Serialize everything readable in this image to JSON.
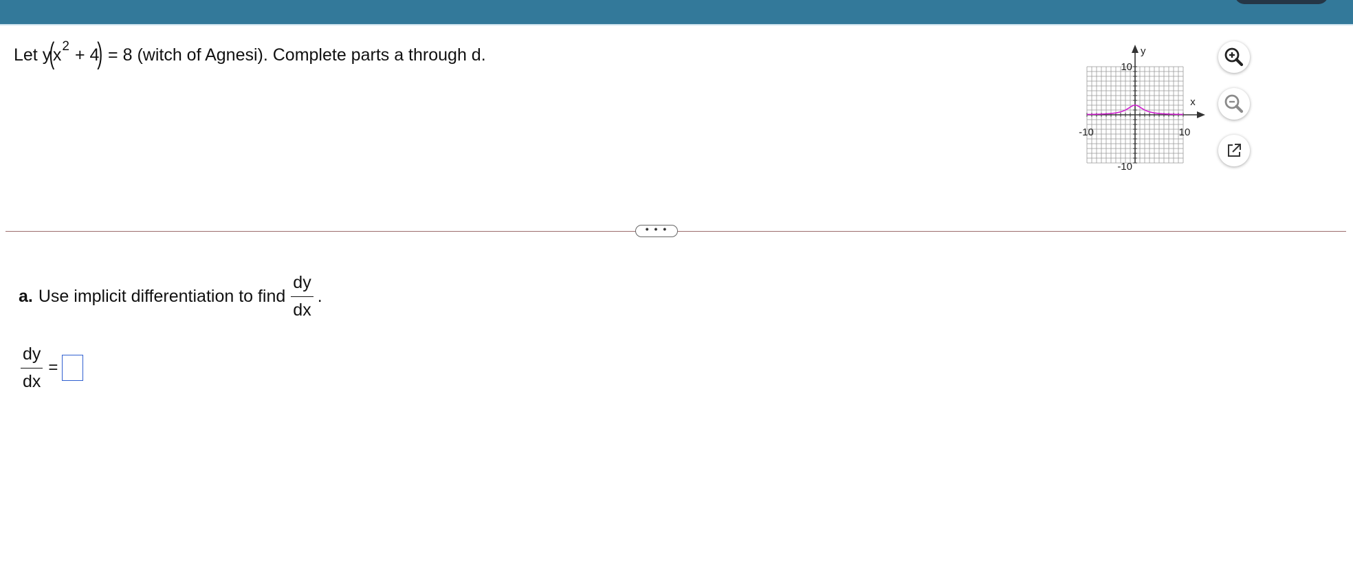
{
  "problem": {
    "let": "Let y",
    "x": "x",
    "exp": "2",
    "plus4": "+ 4",
    "eq8": "= 8 (witch of Agnesi). Complete parts a through d."
  },
  "graph": {
    "y_axis_label": "y",
    "x_axis_label": "x",
    "y_max_label": "10",
    "y_min_label": "-10",
    "x_min_label": "-10",
    "x_max_label": "10",
    "x_range": [
      -10,
      10
    ],
    "y_range": [
      -10,
      10
    ],
    "grid_step": 1,
    "curve": "y = 8/(x^2+4)",
    "curve_color": "#d020d0",
    "grid_color": "#999999"
  },
  "icons": {
    "zoom_in": "zoom-in-icon",
    "zoom_out": "zoom-out-icon",
    "popout": "popout-icon",
    "expander": "more-dots-icon"
  },
  "expander": {
    "dots": "• • •"
  },
  "part_a": {
    "label": "a.",
    "text": "Use implicit differentiation to find",
    "frac_num": "dy",
    "frac_den": "dx",
    "period": "."
  },
  "answer": {
    "frac_num": "dy",
    "frac_den": "dx",
    "equals": "=",
    "value": ""
  },
  "colors": {
    "top_bar": "#33799a",
    "divider": "#9b6b6b",
    "answer_box_border": "#2f5fd0",
    "zoom_icon": "#333333"
  }
}
